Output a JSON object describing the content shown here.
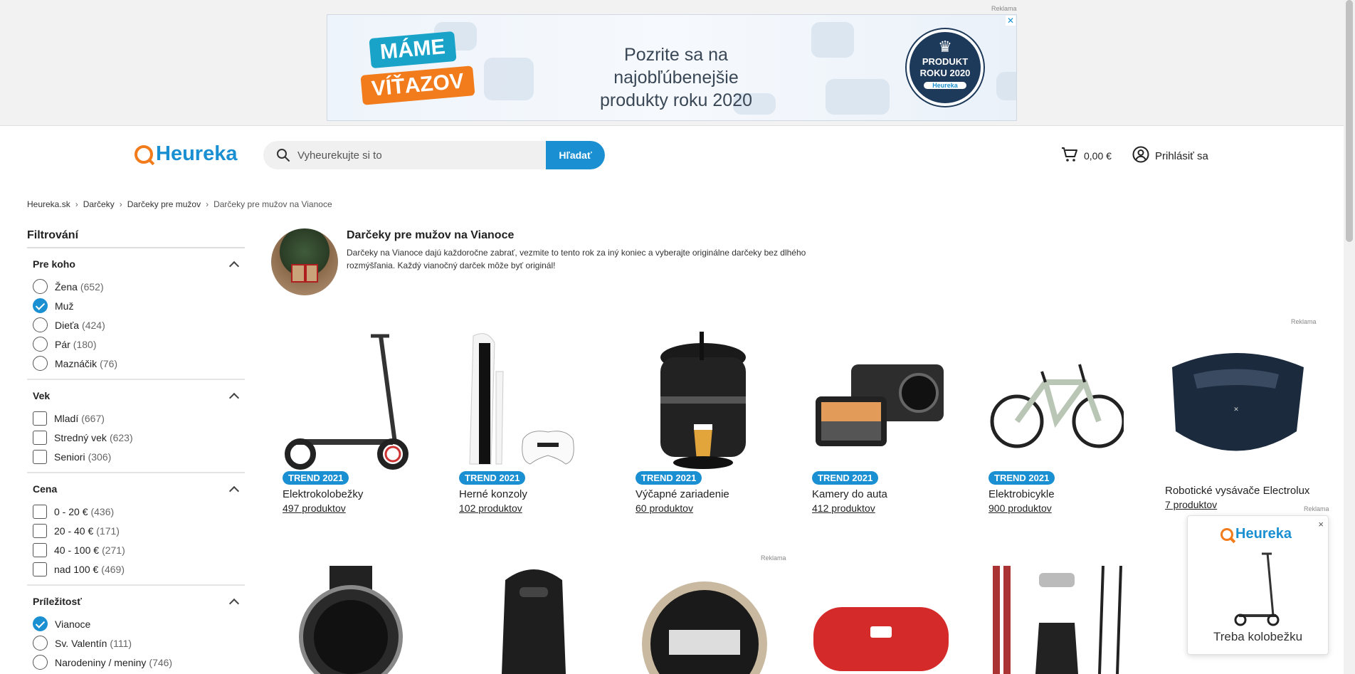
{
  "ad": {
    "label": "Reklama",
    "close": "✕",
    "badge1": "MÁME",
    "badge2": "VÍŤAZOV",
    "text_line1": "Pozrite sa na najobľúbenejšie",
    "text_line2": "produkty roku 2020",
    "seal_line1": "PRODUKT",
    "seal_line2": "ROKU 2020",
    "seal_brand": "Heureka"
  },
  "header": {
    "logo": "Heureka",
    "search_placeholder": "Vyheurekujte si to",
    "search_button": "Hľadať",
    "cart_amount": "0,00 €",
    "login": "Prihlásiť sa"
  },
  "breadcrumb": [
    "Heureka.sk",
    "Darčeky",
    "Darčeky pre mužov",
    "Darčeky pre mužov na Vianoce"
  ],
  "sidebar": {
    "title": "Filtrování",
    "groups": [
      {
        "title": "Pre koho",
        "options": [
          {
            "label": "Žena",
            "count": "(652)"
          },
          {
            "label": "Muž",
            "count": ""
          },
          {
            "label": "Dieťa",
            "count": "(424)"
          },
          {
            "label": "Pár",
            "count": "(180)"
          },
          {
            "label": "Maznáčik",
            "count": "(76)"
          }
        ]
      },
      {
        "title": "Vek",
        "options": [
          {
            "label": "Mladí",
            "count": "(667)"
          },
          {
            "label": "Stredný vek",
            "count": "(623)"
          },
          {
            "label": "Seniori",
            "count": "(306)"
          }
        ]
      },
      {
        "title": "Cena",
        "options": [
          {
            "label": "0 - 20 €",
            "count": "(436)"
          },
          {
            "label": "20 - 40 €",
            "count": "(171)"
          },
          {
            "label": "40 - 100 €",
            "count": "(271)"
          },
          {
            "label": "nad 100 €",
            "count": "(469)"
          }
        ]
      },
      {
        "title": "Príležitosť",
        "options": [
          {
            "label": "Vianoce",
            "count": ""
          },
          {
            "label": "Sv. Valentín",
            "count": "(111)"
          },
          {
            "label": "Narodeniny / meniny",
            "count": "(746)"
          }
        ]
      }
    ]
  },
  "intro": {
    "title": "Darčeky pre mužov na Vianoce",
    "description": "Darčeky na Vianoce dajú každoročne zabrať, vezmite to tento rok za iný koniec a vyberajte originálne darčeky bez dlhého rozmýšľania. Každý vianočný darček môže byť originál!"
  },
  "ad_label": "Reklama",
  "products": [
    {
      "badge": "TREND 2021",
      "name": "Elektrokolobežky",
      "count": "497 produktov"
    },
    {
      "badge": "TREND 2021",
      "name": "Herné konzoly",
      "count": "102 produktov"
    },
    {
      "badge": "TREND 2021",
      "name": "Výčapné zariadenie",
      "count": "60 produktov"
    },
    {
      "badge": "TREND 2021",
      "name": "Kamery do auta",
      "count": "412 produktov"
    },
    {
      "badge": "TREND 2021",
      "name": "Elektrobicykle",
      "count": "900 produktov"
    },
    {
      "badge": "",
      "name": "Robotické vysávače Electrolux",
      "count": "7 produktov"
    }
  ],
  "popup": {
    "logo": "Heureka",
    "close": "×",
    "text": "Treba kolobežku"
  }
}
